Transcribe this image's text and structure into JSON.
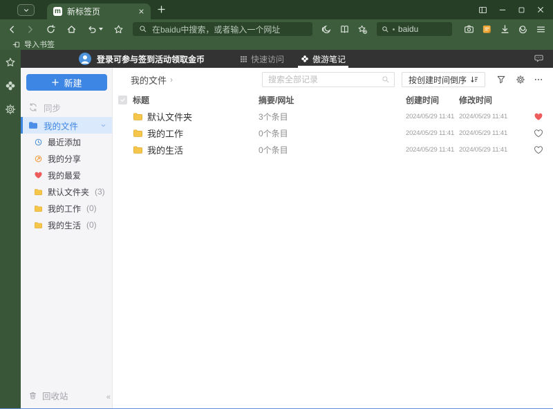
{
  "tab_bar": {
    "logo_glyph": "m",
    "tab_title": "新标签页"
  },
  "navbar": {
    "address_placeholder": "在baidu中搜索，或者输入一个网址",
    "search_value": "baidu"
  },
  "bookmark_bar": {
    "import_label": "导入书签"
  },
  "app_header": {
    "login_text": "登录可参与签到活动领取金币",
    "tab_quick": "快速访问",
    "tab_notes": "傲游笔记"
  },
  "sidebar": {
    "new_label": "新建",
    "sync_label": "同步",
    "my_files_label": "我的文件",
    "items": [
      {
        "label": "最近添加"
      },
      {
        "label": "我的分享"
      },
      {
        "label": "我的最爱"
      },
      {
        "label": "默认文件夹",
        "count": "(3)"
      },
      {
        "label": "我的工作",
        "count": "(0)"
      },
      {
        "label": "我的生活",
        "count": "(0)"
      }
    ],
    "recycle_label": "回收站",
    "collapse_glyph": "«"
  },
  "main": {
    "breadcrumb": "我的文件",
    "breadcrumb_arrow": "›",
    "search_placeholder": "搜索全部记录",
    "sort_label": "按创建时间倒序",
    "table": {
      "headers": {
        "title": "标题",
        "summary": "摘要/网址",
        "created": "创建时间",
        "modified": "修改时间"
      },
      "rows": [
        {
          "title": "默认文件夹",
          "summary": "3个条目",
          "created": "2024/05/29 11:41",
          "modified": "2024/05/29 11:41",
          "favorite": true
        },
        {
          "title": "我的工作",
          "summary": "0个条目",
          "created": "2024/05/29 11:41",
          "modified": "2024/05/29 11:41",
          "favorite": false
        },
        {
          "title": "我的生活",
          "summary": "0个条目",
          "created": "2024/05/29 11:41",
          "modified": "2024/05/29 11:41",
          "favorite": false
        }
      ]
    }
  },
  "colors": {
    "theme_green": "#3c5c3b",
    "titlebar_green": "#253e25",
    "field_green": "#2a452a",
    "rail_green": "#395738",
    "header_dark": "#333333",
    "accent_blue": "#3e86e4",
    "selected_blue_bg": "#dbe9fc",
    "heart_red": "#ee5c5c",
    "folder_yellow": "#f6c64b",
    "note_orange": "#f0a93c"
  }
}
